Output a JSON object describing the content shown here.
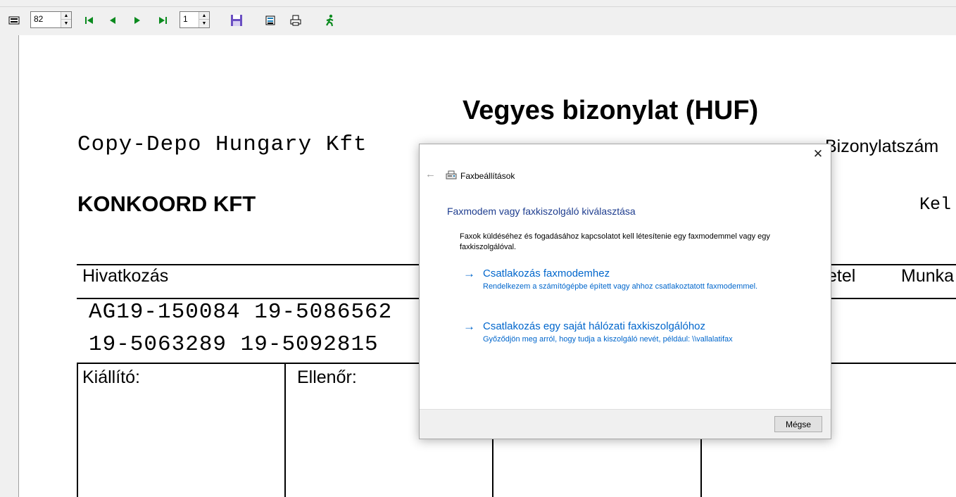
{
  "toolbar": {
    "zoom_value": "82",
    "page_value": "1",
    "icons": [
      "fit-page-icon",
      "first-page-icon",
      "previous-page-icon",
      "next-page-icon",
      "last-page-icon",
      "save-icon",
      "export-icon",
      "print-icon",
      "exit-icon"
    ]
  },
  "document": {
    "title": "Vegyes bizonylat (HUF)",
    "company": "Copy-Depo Hungary Kft",
    "partner": "KONKOORD KFT",
    "doc_number_label": "Bizonylatszám",
    "date_label": "Kel",
    "col_reference": "Hivatkozás",
    "col_right_partial": "etel",
    "col_work": "Munka",
    "ref_line1": "AG19-150084 19-5086562",
    "ref_line2": "19-5063289 19-5092815",
    "issuer_label": "Kiállító:",
    "checker_label": "Ellenőr:"
  },
  "dialog": {
    "window_title": "Faxbeállítások",
    "heading": "Faxmodem vagy faxkiszolgáló kiválasztása",
    "description": "Faxok küldéséhez és fogadásához kapcsolatot kell létesítenie egy faxmodemmel vagy egy faxkiszolgálóval.",
    "option1_title": "Csatlakozás faxmodemhez",
    "option1_sub": "Rendelkezem a számítógépbe épített vagy ahhoz csatlakoztatott faxmodemmel.",
    "option2_title": "Csatlakozás egy saját hálózati faxkiszolgálóhoz",
    "option2_sub": "Győződjön meg arról, hogy tudja a kiszolgáló nevét, például: \\\\vallalatifax",
    "cancel_label": "Mégse",
    "close_glyph": "✕",
    "back_glyph": "←",
    "option_arrow_glyph": "→"
  },
  "colors": {
    "link_blue": "#0066cc",
    "heading_blue": "#1e3d8f",
    "nav_green": "#0a8a1e",
    "save_purple": "#6a4fc2"
  }
}
